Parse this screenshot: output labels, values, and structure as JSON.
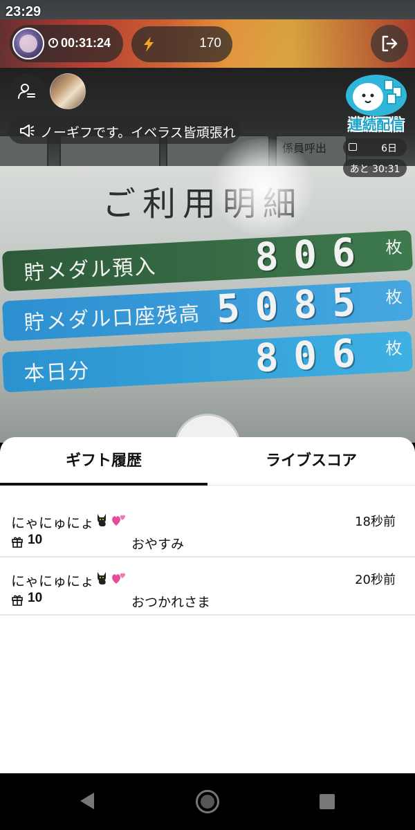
{
  "status_bar": {
    "time": "23:29"
  },
  "camera": {
    "sign_heading": "ご利用明細",
    "operator_call_label": "係員呼出",
    "rows": [
      {
        "label": "貯メダル預入",
        "value": "806",
        "unit": "枚"
      },
      {
        "label": "貯メダル口座残高",
        "value": "5085",
        "unit": "枚"
      },
      {
        "label": "本日分",
        "value": "806",
        "unit": "枚"
      }
    ]
  },
  "stream": {
    "elapsed_time": "00:31:24",
    "points": "170",
    "notice": "ノーギフです。イベラス皆頑張れ",
    "streak_label": "連続配信",
    "streak_days": "6日",
    "remaining": "あと 30:31"
  },
  "sheet": {
    "tabs": [
      {
        "label": "ギフト履歴",
        "active": true
      },
      {
        "label": "ライブスコア",
        "active": false
      }
    ],
    "gifts": [
      {
        "user": "にゃにゅにょ",
        "amount": "10",
        "message": "おやすみ",
        "time": "18秒前"
      },
      {
        "user": "にゃにゅにょ",
        "amount": "10",
        "message": "おつかれさま",
        "time": "20秒前"
      }
    ]
  },
  "icons": {
    "clock": "clock-icon",
    "points": "lightning-icon",
    "exit": "exit-icon",
    "follow": "follow-user-icon",
    "megaphone": "megaphone-icon",
    "calendar": "calendar-icon",
    "gift": "gift-icon",
    "cat": "black-cat-emoji",
    "heart": "pink-hearts-emoji"
  },
  "colors": {
    "streak_accent": "#1aa3c8",
    "heart": "#e84a9a",
    "points_accent": "#f5a623"
  }
}
